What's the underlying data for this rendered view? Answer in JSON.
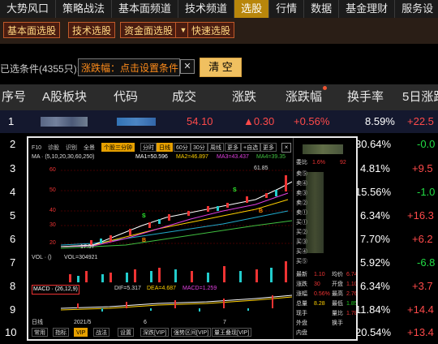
{
  "top_nav": [
    "大势风口",
    "策略战法",
    "基本面频道",
    "技术频道",
    "选股",
    "行情",
    "数据",
    "基金理财",
    "服务设"
  ],
  "top_nav_active": 4,
  "sub_nav": [
    "基本面选股",
    "技术选股",
    "资金面选股",
    "快速选股"
  ],
  "sub_nav_dropdown_arrow": "▼",
  "conditions": {
    "count_label": "已选条件(4355只):",
    "chip_text": "涨跌幅：点击设置条件",
    "chip_close": "✕",
    "clear_button": "清 空"
  },
  "table": {
    "headers": [
      "序号",
      "A股板块",
      "代码",
      "成交",
      "涨跌",
      "涨跌幅",
      "换手率",
      "5日涨跌"
    ],
    "rows": [
      {
        "idx": "1",
        "name": "",
        "code": "",
        "price": "54.10",
        "change": "▲0.30",
        "pct": "+0.56%",
        "turnover": "8.59%",
        "d5": "+22.5"
      },
      {
        "idx": "2",
        "turnover": "30.64%",
        "d5": "-0.0"
      },
      {
        "idx": "3",
        "turnover": "4.81%",
        "d5": "+9.5"
      },
      {
        "idx": "4",
        "turnover": "15.56%",
        "d5": "-1.0"
      },
      {
        "idx": "5",
        "turnover": "6.34%",
        "d5": "+16.3"
      },
      {
        "idx": "6",
        "turnover": "7.70%",
        "d5": "+6.2"
      },
      {
        "idx": "7",
        "turnover": "5.92%",
        "d5": "-6.8"
      },
      {
        "idx": "8",
        "turnover": "6.34%",
        "d5": "+3.7"
      },
      {
        "idx": "9",
        "turnover": "11.84%",
        "d5": "+14.4"
      },
      {
        "idx": "10",
        "turnover": "20.54%",
        "d5": "+13.4"
      }
    ]
  },
  "popup": {
    "toolbar_left": [
      "F10",
      "诊股",
      "识别",
      "全景"
    ],
    "toolbar_right_active": "个股三分钟",
    "periods": [
      "分时",
      "日线",
      "60分",
      "30分",
      "周线",
      "更多"
    ],
    "period_active": "日线",
    "extra_buttons": [
      "+自选",
      "更多"
    ],
    "ma_line": "MA · (5,10,20,30,60,250)",
    "ma1": "MA1=50.596",
    "ma2": "MA2=46.897",
    "ma3": "MA3=43.437",
    "ma4": "MA4=39.35",
    "y_ticks": [
      "60",
      "50",
      "40",
      "30",
      "20"
    ],
    "high_label": "61.85",
    "low_label": "17.57",
    "vol_line": "VOL · ()",
    "vol_value": "VOL=304921",
    "macd_line": "MACD · (26,12,9)",
    "macd_dif": "DIF=5.317",
    "macd_dea": "DEA=4.687",
    "macd_val": "MACD=1.259",
    "date_left": "2021/5",
    "date_mid": "6",
    "date_right": "7",
    "bottom_tabs": [
      "常用",
      "指标",
      "VIP",
      "战法",
      "设置",
      "深跌[VIP]",
      "强势区间[VIP]",
      "量王叠现[VIP]"
    ],
    "bottom_left": "日线",
    "side_labels": [
      "委比",
      "委差",
      "卖⑤",
      "卖④",
      "卖③",
      "卖②",
      "卖①",
      "买①",
      "买②",
      "买③",
      "买④",
      "买⑤",
      "最新",
      "涨跌",
      "涨幅",
      "总量",
      "现手",
      "外盘",
      "内盘",
      "总额"
    ],
    "side_values": [
      "1.10",
      "30",
      "0.56%",
      "8.28",
      "1.78"
    ],
    "side_top_value": "1.6%",
    "side_top_right": "92",
    "side_right_labels": [
      "均价",
      "开盘",
      "最高",
      "最低",
      "量比",
      "换手"
    ],
    "side_right_values": [
      "6.74",
      "1.10",
      "2.76",
      "1.85",
      "1.78",
      ""
    ]
  },
  "colors": {
    "up": "#ff4a4a",
    "down": "#22dd44",
    "accent": "#e6a000"
  }
}
